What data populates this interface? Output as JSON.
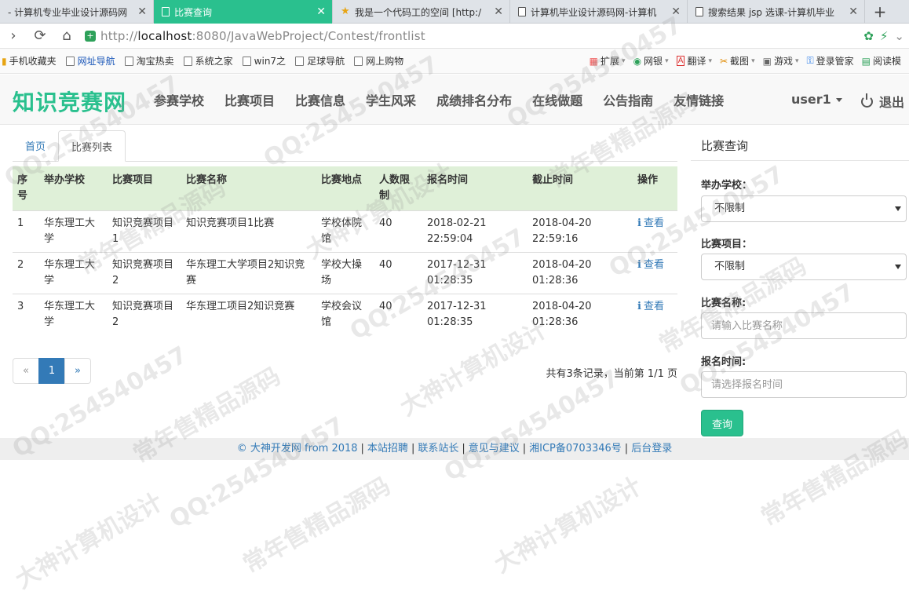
{
  "browser": {
    "tabs": [
      {
        "title": "- 计算机专业毕业设计源码网",
        "active": false
      },
      {
        "title": "比赛查询",
        "active": true
      },
      {
        "title": "我是一个代码工的空间 [http:/",
        "active": false
      },
      {
        "title": "计算机毕业设计源码网-计算机",
        "active": false
      },
      {
        "title": "搜索结果 jsp 选课-计算机毕业",
        "active": false
      }
    ],
    "url_protocol": "http://",
    "url_host": "localhost",
    "url_path": ":8080/JavaWebProject/Contest/frontlist",
    "bookmarks_left": [
      "手机收藏夹",
      "网址导航",
      "淘宝热卖",
      "系统之家",
      "win7之",
      "足球导航",
      "网上购物"
    ],
    "bookmarks_right": [
      "扩展",
      "网银",
      "翻译",
      "截图",
      "游戏",
      "登录管家",
      "阅读模"
    ]
  },
  "site": {
    "brand": "知识竞赛网",
    "menu": [
      "参赛学校",
      "比赛项目",
      "比赛信息",
      "学生风采",
      "成绩排名分布",
      "在线做题",
      "公告指南",
      "友情链接"
    ],
    "user": "user1",
    "logout": "退出"
  },
  "crumbs": {
    "home": "首页",
    "current": "比赛列表"
  },
  "table": {
    "headers": [
      "序号",
      "举办学校",
      "比赛项目",
      "比赛名称",
      "比赛地点",
      "人数限制",
      "报名时间",
      "截止时间",
      "操作"
    ],
    "rows": [
      {
        "no": "1",
        "school": "华东理工大学",
        "item": "知识竞赛项目1",
        "name": "知识竞赛项目1比赛",
        "place": "学校体院馆",
        "limit": "40",
        "start": "2018-02-21 22:59:04",
        "end": "2018-04-20 22:59:16",
        "action": "查看"
      },
      {
        "no": "2",
        "school": "华东理工大学",
        "item": "知识竞赛项目2",
        "name": "华东理工大学项目2知识竞赛",
        "place": "学校大操场",
        "limit": "40",
        "start": "2017-12-31 01:28:35",
        "end": "2018-04-20 01:28:36",
        "action": "查看"
      },
      {
        "no": "3",
        "school": "华东理工大学",
        "item": "知识竞赛项目2",
        "name": "华东理工项目2知识竞赛",
        "place": "学校会议馆",
        "limit": "40",
        "start": "2017-12-31 01:28:35",
        "end": "2018-04-20 01:28:36",
        "action": "查看"
      }
    ]
  },
  "pager": {
    "prev": "«",
    "current": "1",
    "next": "»",
    "info": "共有3条记录，当前第 1/1 页"
  },
  "sidebar": {
    "title": "比赛查询",
    "school_label": "举办学校：",
    "school_value": "不限制",
    "item_label": "比赛项目：",
    "item_value": "不限制",
    "name_label": "比赛名称:",
    "name_placeholder": "请输入比赛名称",
    "time_label": "报名时间:",
    "time_placeholder": "请选择报名时间",
    "query_button": "查询"
  },
  "footer": {
    "copyright": "© 大神开发网 from 2018",
    "links": [
      "本站招聘",
      "联系站长",
      "意见与建议",
      "湘ICP备0703346号",
      "后台登录"
    ]
  },
  "watermarks": [
    "QQ:254540457",
    "常年售精品源码",
    "大神计算机设计"
  ],
  "colors": {
    "brand": "#2ac08e",
    "link": "#337ab7",
    "table_header": "#dff0d8"
  }
}
